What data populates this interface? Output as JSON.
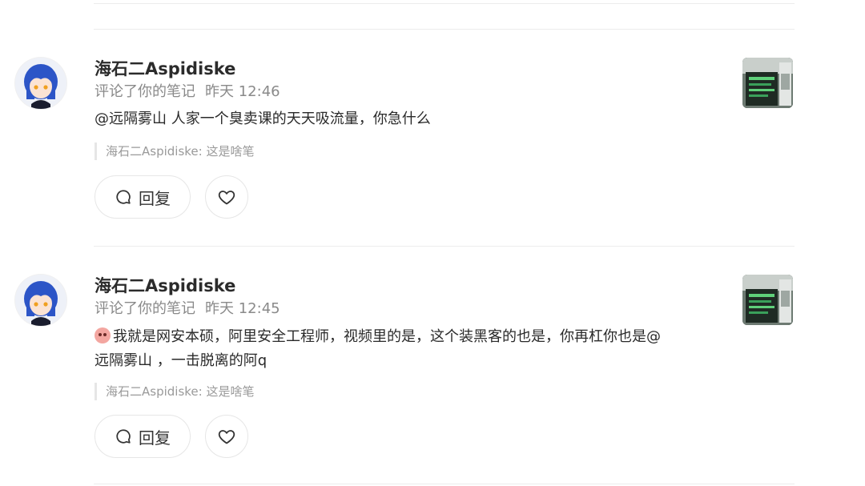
{
  "notifications": [
    {
      "username": "海石二Aspidiske",
      "action": "评论了你的笔记",
      "time": "昨天 12:46",
      "content": "@远隔雾山 人家一个臭卖课的天天吸流量，你急什么",
      "quote": "海石二Aspidiske: 这是啥笔",
      "reply_label": "回复",
      "has_emoji": false
    },
    {
      "username": "海石二Aspidiske",
      "action": "评论了你的笔记",
      "time": "昨天 12:45",
      "content_line1": "我就是网安本硕，阿里安全工程师，视频里的是，这个装黑客的也是，你再杠你也是@",
      "content_line2": "远隔雾山 ，一击脱离的阿q",
      "quote": "海石二Aspidiske: 这是啥笔",
      "reply_label": "回复",
      "has_emoji": true
    }
  ],
  "icons": {
    "reply": "chat-bubble-icon",
    "like": "heart-icon"
  },
  "colors": {
    "meta_text": "#8a8a8a",
    "divider": "#ececec"
  }
}
